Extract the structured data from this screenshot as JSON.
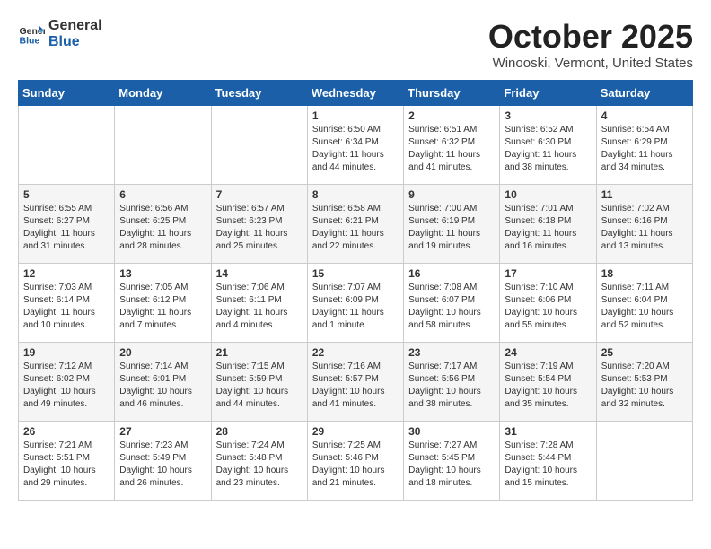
{
  "header": {
    "logo_general": "General",
    "logo_blue": "Blue",
    "month_title": "October 2025",
    "location": "Winooski, Vermont, United States"
  },
  "weekdays": [
    "Sunday",
    "Monday",
    "Tuesday",
    "Wednesday",
    "Thursday",
    "Friday",
    "Saturday"
  ],
  "weeks": [
    [
      {
        "day": "",
        "sunrise": "",
        "sunset": "",
        "daylight": ""
      },
      {
        "day": "",
        "sunrise": "",
        "sunset": "",
        "daylight": ""
      },
      {
        "day": "",
        "sunrise": "",
        "sunset": "",
        "daylight": ""
      },
      {
        "day": "1",
        "sunrise": "Sunrise: 6:50 AM",
        "sunset": "Sunset: 6:34 PM",
        "daylight": "Daylight: 11 hours and 44 minutes."
      },
      {
        "day": "2",
        "sunrise": "Sunrise: 6:51 AM",
        "sunset": "Sunset: 6:32 PM",
        "daylight": "Daylight: 11 hours and 41 minutes."
      },
      {
        "day": "3",
        "sunrise": "Sunrise: 6:52 AM",
        "sunset": "Sunset: 6:30 PM",
        "daylight": "Daylight: 11 hours and 38 minutes."
      },
      {
        "day": "4",
        "sunrise": "Sunrise: 6:54 AM",
        "sunset": "Sunset: 6:29 PM",
        "daylight": "Daylight: 11 hours and 34 minutes."
      }
    ],
    [
      {
        "day": "5",
        "sunrise": "Sunrise: 6:55 AM",
        "sunset": "Sunset: 6:27 PM",
        "daylight": "Daylight: 11 hours and 31 minutes."
      },
      {
        "day": "6",
        "sunrise": "Sunrise: 6:56 AM",
        "sunset": "Sunset: 6:25 PM",
        "daylight": "Daylight: 11 hours and 28 minutes."
      },
      {
        "day": "7",
        "sunrise": "Sunrise: 6:57 AM",
        "sunset": "Sunset: 6:23 PM",
        "daylight": "Daylight: 11 hours and 25 minutes."
      },
      {
        "day": "8",
        "sunrise": "Sunrise: 6:58 AM",
        "sunset": "Sunset: 6:21 PM",
        "daylight": "Daylight: 11 hours and 22 minutes."
      },
      {
        "day": "9",
        "sunrise": "Sunrise: 7:00 AM",
        "sunset": "Sunset: 6:19 PM",
        "daylight": "Daylight: 11 hours and 19 minutes."
      },
      {
        "day": "10",
        "sunrise": "Sunrise: 7:01 AM",
        "sunset": "Sunset: 6:18 PM",
        "daylight": "Daylight: 11 hours and 16 minutes."
      },
      {
        "day": "11",
        "sunrise": "Sunrise: 7:02 AM",
        "sunset": "Sunset: 6:16 PM",
        "daylight": "Daylight: 11 hours and 13 minutes."
      }
    ],
    [
      {
        "day": "12",
        "sunrise": "Sunrise: 7:03 AM",
        "sunset": "Sunset: 6:14 PM",
        "daylight": "Daylight: 11 hours and 10 minutes."
      },
      {
        "day": "13",
        "sunrise": "Sunrise: 7:05 AM",
        "sunset": "Sunset: 6:12 PM",
        "daylight": "Daylight: 11 hours and 7 minutes."
      },
      {
        "day": "14",
        "sunrise": "Sunrise: 7:06 AM",
        "sunset": "Sunset: 6:11 PM",
        "daylight": "Daylight: 11 hours and 4 minutes."
      },
      {
        "day": "15",
        "sunrise": "Sunrise: 7:07 AM",
        "sunset": "Sunset: 6:09 PM",
        "daylight": "Daylight: 11 hours and 1 minute."
      },
      {
        "day": "16",
        "sunrise": "Sunrise: 7:08 AM",
        "sunset": "Sunset: 6:07 PM",
        "daylight": "Daylight: 10 hours and 58 minutes."
      },
      {
        "day": "17",
        "sunrise": "Sunrise: 7:10 AM",
        "sunset": "Sunset: 6:06 PM",
        "daylight": "Daylight: 10 hours and 55 minutes."
      },
      {
        "day": "18",
        "sunrise": "Sunrise: 7:11 AM",
        "sunset": "Sunset: 6:04 PM",
        "daylight": "Daylight: 10 hours and 52 minutes."
      }
    ],
    [
      {
        "day": "19",
        "sunrise": "Sunrise: 7:12 AM",
        "sunset": "Sunset: 6:02 PM",
        "daylight": "Daylight: 10 hours and 49 minutes."
      },
      {
        "day": "20",
        "sunrise": "Sunrise: 7:14 AM",
        "sunset": "Sunset: 6:01 PM",
        "daylight": "Daylight: 10 hours and 46 minutes."
      },
      {
        "day": "21",
        "sunrise": "Sunrise: 7:15 AM",
        "sunset": "Sunset: 5:59 PM",
        "daylight": "Daylight: 10 hours and 44 minutes."
      },
      {
        "day": "22",
        "sunrise": "Sunrise: 7:16 AM",
        "sunset": "Sunset: 5:57 PM",
        "daylight": "Daylight: 10 hours and 41 minutes."
      },
      {
        "day": "23",
        "sunrise": "Sunrise: 7:17 AM",
        "sunset": "Sunset: 5:56 PM",
        "daylight": "Daylight: 10 hours and 38 minutes."
      },
      {
        "day": "24",
        "sunrise": "Sunrise: 7:19 AM",
        "sunset": "Sunset: 5:54 PM",
        "daylight": "Daylight: 10 hours and 35 minutes."
      },
      {
        "day": "25",
        "sunrise": "Sunrise: 7:20 AM",
        "sunset": "Sunset: 5:53 PM",
        "daylight": "Daylight: 10 hours and 32 minutes."
      }
    ],
    [
      {
        "day": "26",
        "sunrise": "Sunrise: 7:21 AM",
        "sunset": "Sunset: 5:51 PM",
        "daylight": "Daylight: 10 hours and 29 minutes."
      },
      {
        "day": "27",
        "sunrise": "Sunrise: 7:23 AM",
        "sunset": "Sunset: 5:49 PM",
        "daylight": "Daylight: 10 hours and 26 minutes."
      },
      {
        "day": "28",
        "sunrise": "Sunrise: 7:24 AM",
        "sunset": "Sunset: 5:48 PM",
        "daylight": "Daylight: 10 hours and 23 minutes."
      },
      {
        "day": "29",
        "sunrise": "Sunrise: 7:25 AM",
        "sunset": "Sunset: 5:46 PM",
        "daylight": "Daylight: 10 hours and 21 minutes."
      },
      {
        "day": "30",
        "sunrise": "Sunrise: 7:27 AM",
        "sunset": "Sunset: 5:45 PM",
        "daylight": "Daylight: 10 hours and 18 minutes."
      },
      {
        "day": "31",
        "sunrise": "Sunrise: 7:28 AM",
        "sunset": "Sunset: 5:44 PM",
        "daylight": "Daylight: 10 hours and 15 minutes."
      },
      {
        "day": "",
        "sunrise": "",
        "sunset": "",
        "daylight": ""
      }
    ]
  ]
}
